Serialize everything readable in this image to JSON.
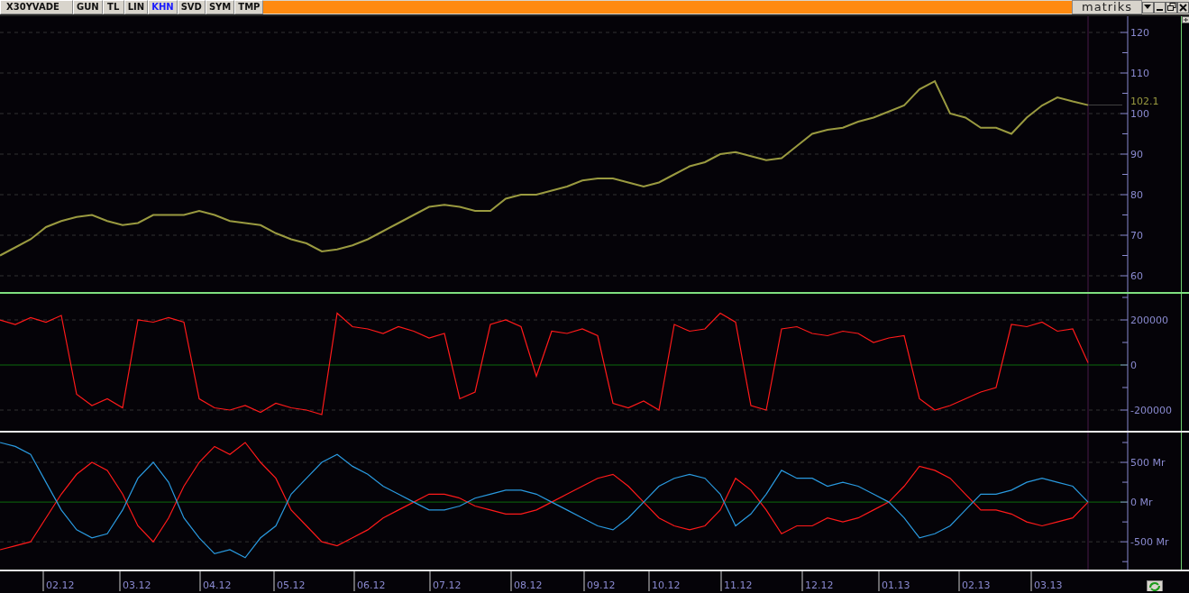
{
  "toolbar": {
    "symbol": "X30YVADE",
    "tabs": [
      {
        "label": "GUN",
        "selected": false
      },
      {
        "label": "TL",
        "selected": false
      },
      {
        "label": "LIN",
        "selected": false
      },
      {
        "label": "KHN",
        "selected": true
      },
      {
        "label": "SVD",
        "selected": false
      },
      {
        "label": "SYM",
        "selected": false
      },
      {
        "label": "TMP",
        "selected": false
      }
    ],
    "logo": "matriks"
  },
  "panels": [
    {
      "last_value_label": "102.1",
      "chart_data": {
        "type": "line",
        "grid": true,
        "ylim": [
          56,
          124
        ],
        "yticks": [
          60,
          70,
          80,
          90,
          100,
          110,
          120
        ],
        "series": [
          {
            "color": "#9a9a40",
            "values": [
              65,
              67,
              69,
              72,
              73.5,
              74.5,
              75,
              73.5,
              72.5,
              73,
              75,
              75,
              75,
              76,
              75,
              73.5,
              73,
              72.5,
              70.5,
              69,
              68,
              66,
              66.5,
              67.5,
              69,
              71,
              73,
              75,
              77,
              77.5,
              77,
              76,
              76,
              79,
              80,
              80,
              81,
              82,
              83.5,
              84,
              84,
              83,
              82,
              83,
              85,
              87,
              88,
              90,
              90.5,
              89.5,
              88.5,
              89,
              92,
              95,
              96,
              96.5,
              98,
              99,
              100.5,
              102,
              106,
              108,
              100,
              99,
              96.5,
              96.5,
              95,
              99,
              102,
              104,
              103,
              102.1
            ]
          }
        ]
      }
    },
    {
      "chart_data": {
        "type": "line",
        "grid": true,
        "ref_lines": [
          {
            "axis": "y",
            "value": 0
          }
        ],
        "ylim": [
          -292000,
          316000
        ],
        "yticks": [
          -200000,
          0,
          200000
        ],
        "series": [
          {
            "color": "#ff1a1a",
            "values": [
              200000,
              180000,
              210000,
              190000,
              220000,
              -130000,
              -180000,
              -150000,
              -190000,
              200000,
              190000,
              210000,
              190000,
              -150000,
              -190000,
              -200000,
              -180000,
              -210000,
              -170000,
              -190000,
              -200000,
              -220000,
              230000,
              170000,
              160000,
              140000,
              170000,
              150000,
              120000,
              140000,
              -150000,
              -120000,
              180000,
              200000,
              170000,
              -50000,
              150000,
              140000,
              160000,
              130000,
              -170000,
              -190000,
              -160000,
              -200000,
              180000,
              150000,
              160000,
              230000,
              190000,
              -180000,
              -200000,
              160000,
              170000,
              140000,
              130000,
              150000,
              140000,
              100000,
              120000,
              130000,
              -150000,
              -200000,
              -180000,
              -150000,
              -120000,
              -100000,
              180000,
              170000,
              190000,
              150000,
              160000,
              10000
            ]
          }
        ]
      }
    },
    {
      "chart_data": {
        "type": "line",
        "grid": true,
        "ref_lines": [
          {
            "axis": "y",
            "value": 0
          }
        ],
        "ylim": [
          -850,
          875
        ],
        "yticks": [
          {
            "value": -500,
            "label": "-500 Mr"
          },
          {
            "value": 0,
            "label": "0 Mr"
          },
          {
            "value": 500,
            "label": "500 Mr"
          }
        ],
        "series": [
          {
            "color": "#ff1a1a",
            "values": [
              -600,
              -550,
              -500,
              -200,
              100,
              350,
              500,
              400,
              100,
              -300,
              -500,
              -200,
              200,
              500,
              700,
              600,
              750,
              500,
              300,
              -100,
              -300,
              -500,
              -550,
              -450,
              -350,
              -200,
              -100,
              0,
              100,
              100,
              50,
              -50,
              -100,
              -150,
              -150,
              -100,
              0,
              100,
              200,
              300,
              350,
              200,
              0,
              -200,
              -300,
              -350,
              -300,
              -100,
              300,
              150,
              -100,
              -400,
              -300,
              -300,
              -200,
              -250,
              -200,
              -100,
              0,
              200,
              450,
              400,
              300,
              100,
              -100,
              -100,
              -150,
              -250,
              -300,
              -250,
              -200,
              0
            ]
          },
          {
            "color": "#2a9ae0",
            "values": [
              750,
              700,
              600,
              250,
              -100,
              -350,
              -450,
              -400,
              -100,
              300,
              500,
              250,
              -200,
              -450,
              -650,
              -600,
              -700,
              -450,
              -300,
              100,
              300,
              500,
              600,
              450,
              350,
              200,
              100,
              0,
              -100,
              -100,
              -50,
              50,
              100,
              150,
              150,
              100,
              0,
              -100,
              -200,
              -300,
              -350,
              -200,
              0,
              200,
              300,
              350,
              300,
              100,
              -300,
              -150,
              100,
              400,
              300,
              300,
              200,
              250,
              200,
              100,
              0,
              -200,
              -450,
              -400,
              -300,
              -100,
              100,
              100,
              150,
              250,
              300,
              250,
              200,
              0
            ]
          }
        ]
      }
    }
  ],
  "date_axis": [
    "02.12",
    "03.12",
    "04.12",
    "05.12",
    "06.12",
    "07.12",
    "08.12",
    "09.12",
    "10.12",
    "11.12",
    "12.12",
    "01.13",
    "02.13",
    "03.13"
  ]
}
